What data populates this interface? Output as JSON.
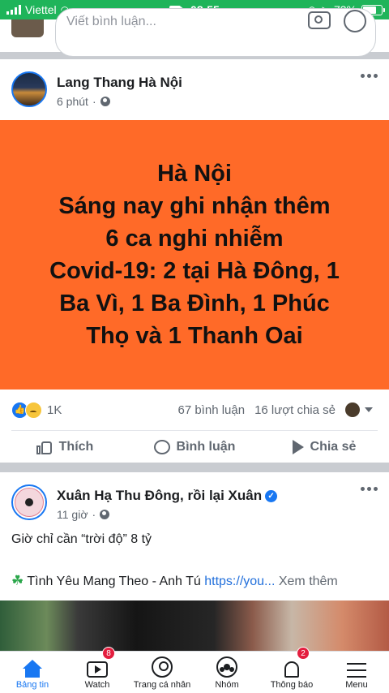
{
  "status_bar": {
    "carrier": "Viettel",
    "time": "08:55",
    "battery": "73%"
  },
  "comment_box": {
    "placeholder": "Viết bình luận..."
  },
  "post1": {
    "author": "Lang Thang Hà Nội",
    "time": "6 phút",
    "banner_lines": [
      "Hà Nội",
      "Sáng nay ghi nhận thêm",
      "6 ca nghi nhiễm",
      "Covid-19: 2 tại Hà Đông, 1",
      "Ba Vì, 1 Ba Đình, 1 Phúc",
      "Thọ và 1 Thanh Oai"
    ],
    "reactions_count": "1K",
    "comments_count": "67 bình luận",
    "shares_count": "16 lượt chia sẻ",
    "actions": {
      "like": "Thích",
      "comment": "Bình luận",
      "share": "Chia sẻ"
    }
  },
  "post2": {
    "author": "Xuân Hạ Thu Đông, rồi lại Xuân",
    "time": "11 giờ",
    "text": "Giờ chỉ cần “trời độ” 8 tỷ",
    "song": "Tình Yêu Mang Theo - Anh Tú",
    "link": "https://you...",
    "see_more": "Xem thêm"
  },
  "nav": {
    "items": [
      {
        "label": "Bảng tin",
        "icon": "home-icon",
        "badge": ""
      },
      {
        "label": "Watch",
        "icon": "watch-icon",
        "badge": "8"
      },
      {
        "label": "Trang cá nhân",
        "icon": "profile-icon",
        "badge": ""
      },
      {
        "label": "Nhóm",
        "icon": "groups-icon",
        "badge": ""
      },
      {
        "label": "Thông báo",
        "icon": "bell-icon",
        "badge": "2"
      },
      {
        "label": "Menu",
        "icon": "menu-icon",
        "badge": ""
      }
    ]
  },
  "colors": {
    "accent": "#1877f2",
    "banner": "#ff6a28",
    "status_bar": "#1fb45a",
    "badge": "#e41e3f"
  }
}
